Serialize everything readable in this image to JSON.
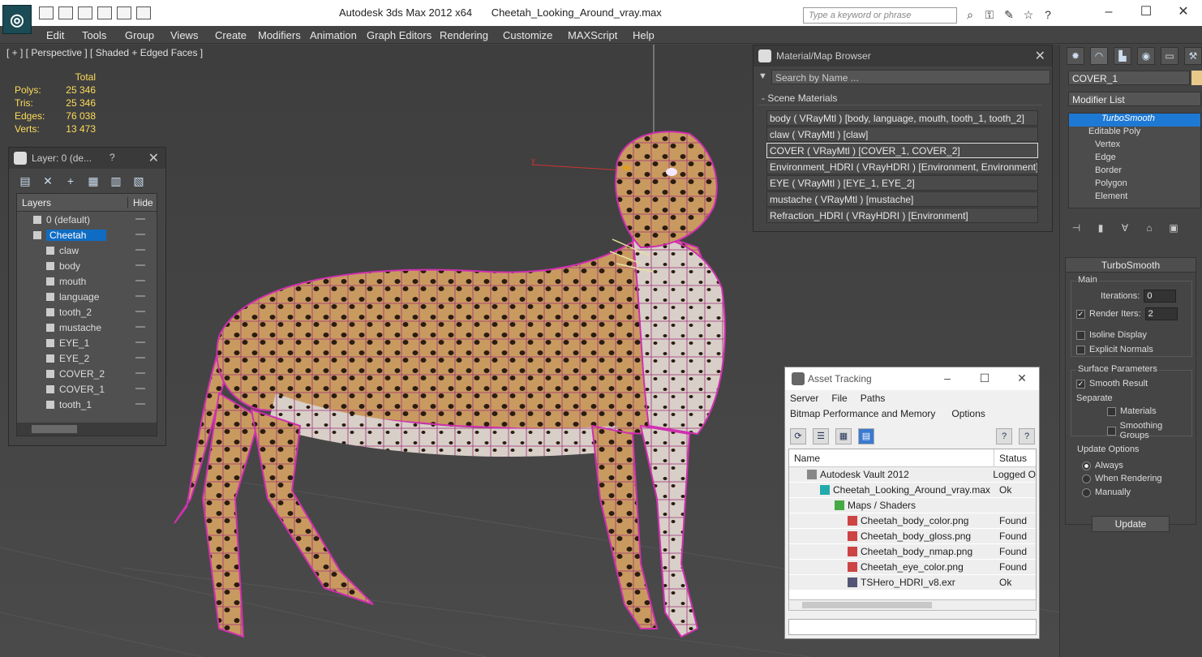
{
  "titlebar": {
    "app_name": "Autodesk 3ds Max  2012 x64",
    "file_name": "Cheetah_Looking_Around_vray.max",
    "search_placeholder": "Type a keyword or phrase"
  },
  "menu": [
    "Edit",
    "Tools",
    "Group",
    "Views",
    "Create",
    "Modifiers",
    "Animation",
    "Graph Editors",
    "Rendering",
    "Customize",
    "MAXScript",
    "Help"
  ],
  "viewport": {
    "label": "[ + ] [ Perspective ] [ Shaded + Edged Faces ]",
    "stats_header": "Total",
    "stats": [
      {
        "k": "Polys:",
        "v": "25 346"
      },
      {
        "k": "Tris:",
        "v": "25 346"
      },
      {
        "k": "Edges:",
        "v": "76 038"
      },
      {
        "k": "Verts:",
        "v": "13 473"
      }
    ],
    "axis_label": "y"
  },
  "layer_panel": {
    "title": "Layer: 0 (de...",
    "help": "?",
    "col_layers": "Layers",
    "col_hide": "Hide",
    "rows": [
      {
        "name": "0 (default)",
        "level": 0
      },
      {
        "name": "Cheetah",
        "level": 0,
        "selected": true
      },
      {
        "name": "claw",
        "level": 1
      },
      {
        "name": "body",
        "level": 1
      },
      {
        "name": "mouth",
        "level": 1
      },
      {
        "name": "language",
        "level": 1
      },
      {
        "name": "tooth_2",
        "level": 1
      },
      {
        "name": "mustache",
        "level": 1
      },
      {
        "name": "EYE_1",
        "level": 1
      },
      {
        "name": "EYE_2",
        "level": 1
      },
      {
        "name": "COVER_2",
        "level": 1
      },
      {
        "name": "COVER_1",
        "level": 1
      },
      {
        "name": "tooth_1",
        "level": 1
      }
    ]
  },
  "material_browser": {
    "title": "Material/Map Browser",
    "search_placeholder": "Search by Name ...",
    "section": "- Scene Materials",
    "items": [
      "body  ( VRayMtl ) [body, language, mouth, tooth_1, tooth_2]",
      "claw  ( VRayMtl ) [claw]",
      "COVER  ( VRayMtl ) [COVER_1, COVER_2]",
      "Environment_HDRI  ( VRayHDRI ) [Environment, Environment]",
      "EYE  ( VRayMtl ) [EYE_1, EYE_2]",
      "mustache  ( VRayMtl ) [mustache]",
      "Refraction_HDRI  ( VRayHDRI ) [Environment]"
    ]
  },
  "command_panel": {
    "object_name": "COVER_1",
    "modifier_list": "Modifier List",
    "stack": [
      {
        "label": "TurboSmooth",
        "type": "ts"
      },
      {
        "label": "Editable Poly",
        "type": "base"
      },
      {
        "label": "Vertex",
        "type": "sub"
      },
      {
        "label": "Edge",
        "type": "sub"
      },
      {
        "label": "Border",
        "type": "sub"
      },
      {
        "label": "Polygon",
        "type": "sub"
      },
      {
        "label": "Element",
        "type": "sub"
      }
    ],
    "rollout_title": "TurboSmooth",
    "main_label": "Main",
    "iterations_label": "Iterations:",
    "iterations_value": "0",
    "render_iters_label": "Render Iters:",
    "render_iters_value": "2",
    "isoline_label": "Isoline Display",
    "explicit_normals_label": "Explicit Normals",
    "surface_label": "Surface Parameters",
    "smooth_result_label": "Smooth Result",
    "separate_label": "Separate",
    "materials_label": "Materials",
    "smoothing_groups_label": "Smoothing Groups",
    "update_options_label": "Update Options",
    "always_label": "Always",
    "when_rendering_label": "When Rendering",
    "manually_label": "Manually",
    "update_button": "Update"
  },
  "asset_tracking": {
    "title": "Asset Tracking",
    "menu1": [
      "Server",
      "File",
      "Paths"
    ],
    "menu2": [
      "Bitmap Performance and Memory",
      "Options"
    ],
    "col_name": "Name",
    "col_status": "Status",
    "rows": [
      {
        "name": "Autodesk Vault 2012",
        "status": "Logged O",
        "indent": 22,
        "icon": "#888"
      },
      {
        "name": "Cheetah_Looking_Around_vray.max",
        "status": "Ok",
        "indent": 38,
        "icon": "#2aa"
      },
      {
        "name": "Maps / Shaders",
        "status": "",
        "indent": 56,
        "icon": "#4a4"
      },
      {
        "name": "Cheetah_body_color.png",
        "status": "Found",
        "indent": 72,
        "icon": "#c44"
      },
      {
        "name": "Cheetah_body_gloss.png",
        "status": "Found",
        "indent": 72,
        "icon": "#c44"
      },
      {
        "name": "Cheetah_body_nmap.png",
        "status": "Found",
        "indent": 72,
        "icon": "#c44"
      },
      {
        "name": "Cheetah_eye_color.png",
        "status": "Found",
        "indent": 72,
        "icon": "#c44"
      },
      {
        "name": "TSHero_HDRI_v8.exr",
        "status": "Ok",
        "indent": 72,
        "icon": "#557"
      }
    ]
  }
}
